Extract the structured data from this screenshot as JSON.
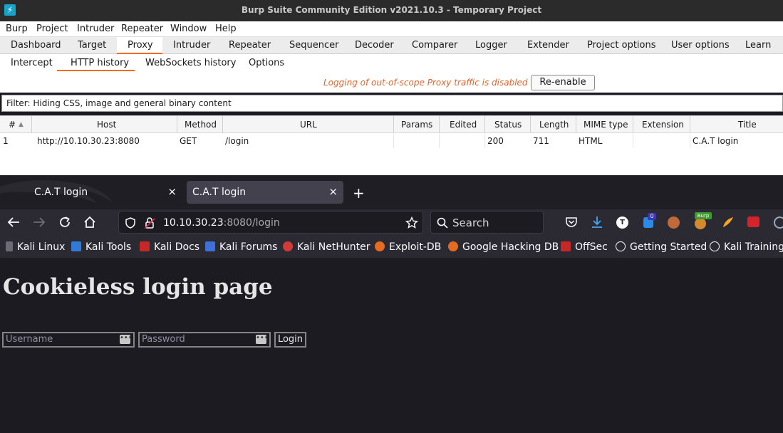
{
  "window": {
    "title": "Burp Suite Community Edition v2021.10.3 - Temporary Project"
  },
  "menu": [
    "Burp",
    "Project",
    "Intruder",
    "Repeater",
    "Window",
    "Help"
  ],
  "main_tabs": [
    "Dashboard",
    "Target",
    "Proxy",
    "Intruder",
    "Repeater",
    "Sequencer",
    "Decoder",
    "Comparer",
    "Logger",
    "Extender",
    "Project options",
    "User options",
    "Learn"
  ],
  "proxy_tabs": [
    "Intercept",
    "HTTP history",
    "WebSockets history",
    "Options"
  ],
  "proxy_warning": "Logging of out-of-scope Proxy traffic is disabled",
  "reenable_label": "Re-enable",
  "filter_text": "Filter: Hiding CSS, image and general binary content",
  "history_table": {
    "columns": [
      "#",
      "Host",
      "Method",
      "URL",
      "Params",
      "Edited",
      "Status",
      "Length",
      "MIME type",
      "Extension",
      "Title"
    ],
    "sort_indicator": "▲",
    "rows": [
      {
        "num": "1",
        "host": "http://10.10.30.23:8080",
        "method": "GET",
        "url": "/login",
        "params": "",
        "edited": "",
        "status": "200",
        "length": "711",
        "mime": "HTML",
        "extension": "",
        "title": "C.A.T login"
      }
    ]
  },
  "browser": {
    "tabs": [
      {
        "label": "C.A.T login",
        "close": "×"
      },
      {
        "label": "C.A.T login",
        "close": "×"
      }
    ],
    "new_tab": "+",
    "url_host": "10.10.30.23",
    "url_path": ":8080/login",
    "search_placeholder": "Search",
    "ext_badges": {
      "notifications": "0",
      "burp": "Burp"
    },
    "bookmarks": [
      "Kali Linux",
      "Kali Tools",
      "Kali Docs",
      "Kali Forums",
      "Kali NetHunter",
      "Exploit-DB",
      "Google Hacking DB",
      "OffSec",
      "Getting Started",
      "Kali Training"
    ]
  },
  "page": {
    "heading": "Cookieless login page",
    "username_placeholder": "Username",
    "password_placeholder": "Password",
    "login_label": "Login"
  },
  "colors": {
    "burp_accent": "#f26a21",
    "warning_text": "#e8632a",
    "firefox_dark": "#2b2a33",
    "page_bg": "#1c1b22"
  }
}
